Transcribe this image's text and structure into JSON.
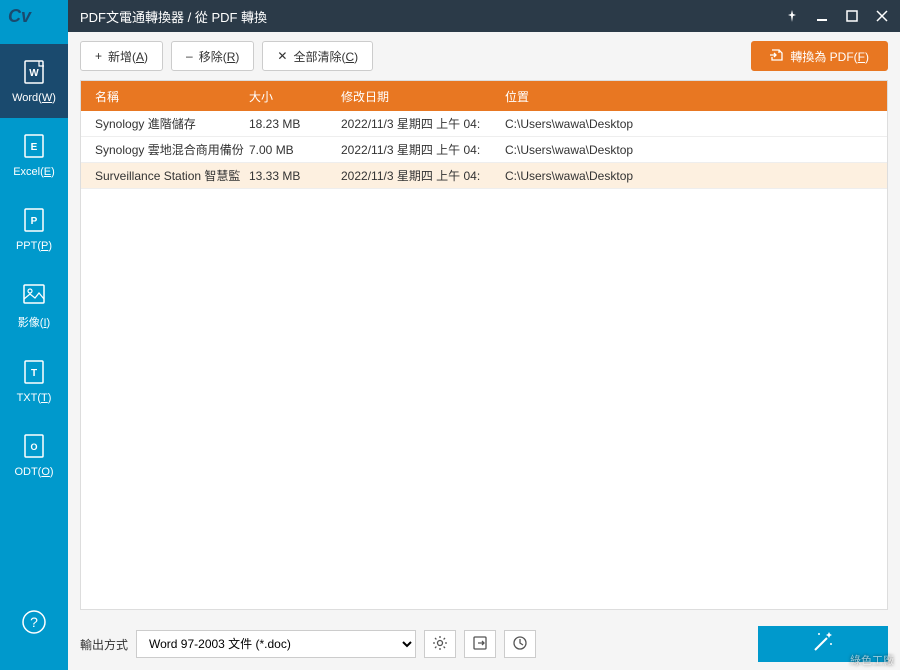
{
  "titlebar": {
    "logo": "Cv",
    "title": "PDF文電通轉換器 / 從 PDF 轉換"
  },
  "sidebar": {
    "items": [
      {
        "id": "word",
        "label": "Word(W)",
        "key": "W"
      },
      {
        "id": "excel",
        "label": "Excel(E)",
        "key": "E"
      },
      {
        "id": "ppt",
        "label": "PPT(P)",
        "key": "P"
      },
      {
        "id": "image",
        "label": "影像(I)",
        "key": "I"
      },
      {
        "id": "txt",
        "label": "TXT(T)",
        "key": "T"
      },
      {
        "id": "odt",
        "label": "ODT(O)",
        "key": "O"
      }
    ]
  },
  "toolbar": {
    "add": "新增(A)",
    "remove": "移除(R)",
    "clear": "全部清除(C)",
    "convert": "轉換為 PDF(F)"
  },
  "table": {
    "headers": {
      "name": "名稱",
      "size": "大小",
      "date": "修改日期",
      "location": "位置"
    },
    "rows": [
      {
        "name": "Synology 進階儲存",
        "size": "18.23 MB",
        "date": "2022/11/3 星期四 上午 04:",
        "location": "C:\\Users\\wawa\\Desktop"
      },
      {
        "name": "Synology 雲地混合商用備份",
        "size": "7.00 MB",
        "date": "2022/11/3 星期四 上午 04:",
        "location": "C:\\Users\\wawa\\Desktop"
      },
      {
        "name": "Surveillance Station 智慧監",
        "size": "13.33 MB",
        "date": "2022/11/3 星期四 上午 04:",
        "location": "C:\\Users\\wawa\\Desktop"
      }
    ],
    "selected_index": 2
  },
  "footer": {
    "label": "輸出方式",
    "selected": "Word 97-2003 文件 (*.doc)"
  },
  "watermark": "綠色工廠"
}
